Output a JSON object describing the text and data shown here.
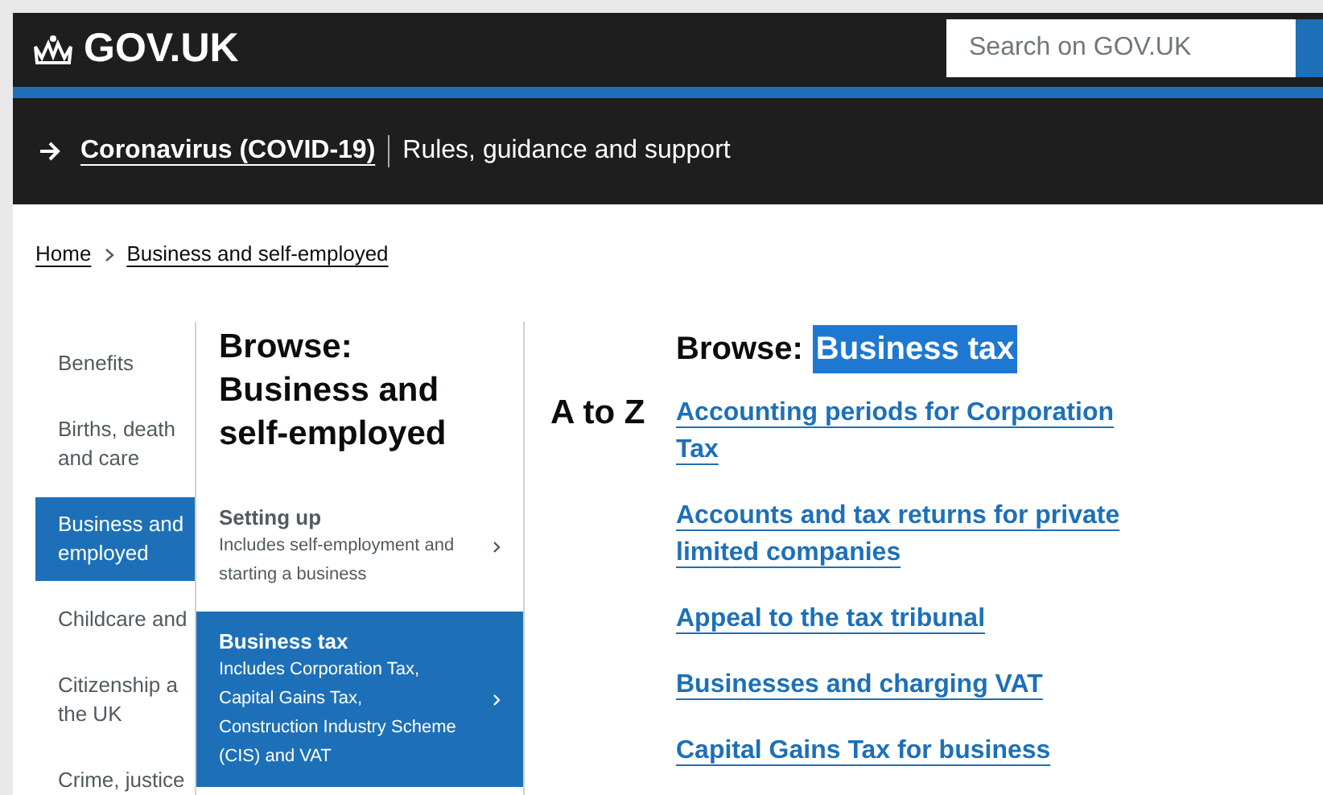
{
  "header": {
    "logo": "GOV.UK",
    "search": {
      "placeholder": "Search on GOV.UK"
    }
  },
  "banner": {
    "link": "Coronavirus (COVID-19)",
    "text": "Rules, guidance and support"
  },
  "breadcrumbs": [
    "Home",
    "Business and self-employed"
  ],
  "left_nav": [
    {
      "lines": [
        "Benefits"
      ],
      "selected": false
    },
    {
      "lines": [
        "Births, death",
        "and care"
      ],
      "selected": false
    },
    {
      "lines": [
        "Business and",
        "employed"
      ],
      "selected": true
    },
    {
      "lines": [
        "Childcare and"
      ],
      "selected": false
    },
    {
      "lines": [
        "Citizenship a",
        "the UK"
      ],
      "selected": false
    },
    {
      "lines": [
        "Crime, justice"
      ],
      "selected": false
    }
  ],
  "middle": {
    "title": "Browse: Business and self-employed",
    "items": [
      {
        "title": "Setting up",
        "description": "Includes self-employment and starting a business",
        "selected": false
      },
      {
        "title": "Business tax",
        "description": "Includes Corporation Tax, Capital Gains Tax, Construction Industry Scheme (CIS) and VAT",
        "selected": true
      }
    ]
  },
  "right": {
    "heading": "Browse:",
    "heading_highlight": {
      "text": "Business tax",
      "selected": true
    },
    "a_to_z": "A to Z",
    "links": [
      "Accounting periods for Corporation Tax",
      "Accounts and tax returns for private limited companies",
      "Appeal to the tax tribunal",
      "Businesses and charging VAT",
      "Capital Gains Tax for business"
    ]
  }
}
